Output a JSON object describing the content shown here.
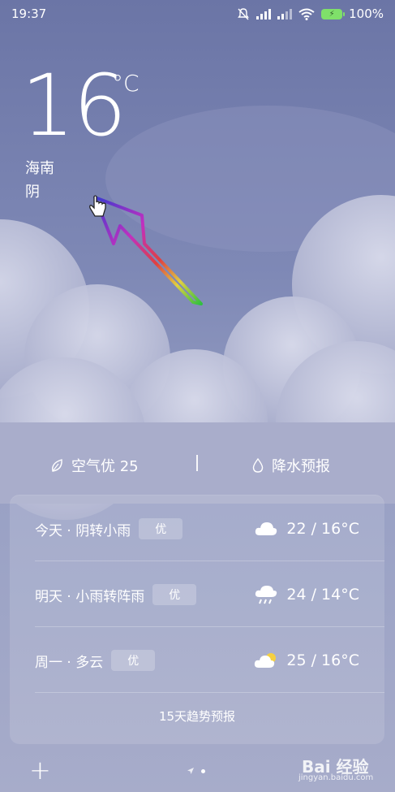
{
  "status_bar": {
    "time": "19:37",
    "battery_percent": "100%"
  },
  "current": {
    "temperature": "16",
    "unit": "°C",
    "location": "海南",
    "condition": "阴"
  },
  "info": {
    "air_quality": "空气优 25",
    "rain_forecast": "降水预报"
  },
  "forecast": [
    {
      "label": "今天 · 阴转小雨",
      "aqi": "优",
      "icon": "cloud-icon",
      "temp": "22 / 16°C"
    },
    {
      "label": "明天 · 小雨转阵雨",
      "aqi": "优",
      "icon": "rain-cloud-icon",
      "temp": "24 / 14°C"
    },
    {
      "label": "周一 · 多云",
      "aqi": "优",
      "icon": "partly-cloudy-icon",
      "temp": "25 / 16°C"
    }
  ],
  "trend_link": "15天趋势预报",
  "watermark": {
    "brand": "Bai 经验",
    "url": "jingyan.baidu.com"
  },
  "colors": {
    "background_top": "#6b75a6",
    "background_bottom": "#a7acca",
    "battery": "#7fe06a"
  }
}
